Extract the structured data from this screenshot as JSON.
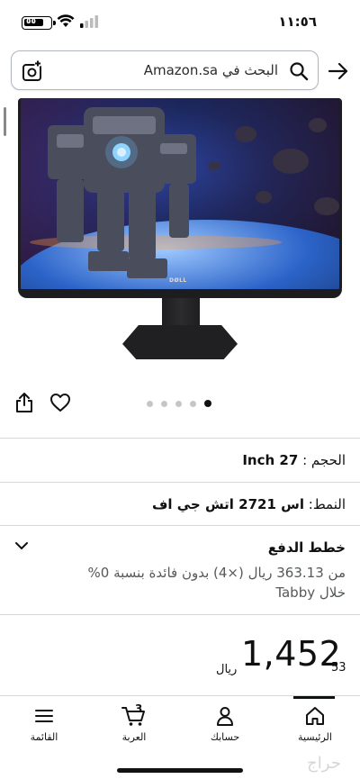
{
  "status_bar": {
    "time": "١١:٥٦",
    "battery_percent": "٥٥"
  },
  "search": {
    "placeholder": "البحث في Amazon.sa"
  },
  "gallery": {
    "image_count": 5,
    "active_index": 4,
    "brand_logo_text": "DØLL"
  },
  "specs": {
    "size": {
      "label": "الحجم :",
      "value": "27 Inch"
    },
    "style": {
      "label": "النمط:",
      "value": "اس 2721 اتش جي اف"
    }
  },
  "payment": {
    "title": "خطط الدفع",
    "description": "من 363.13 ريال (×4) بدون فائدة بنسبة 0% خلال Tabby"
  },
  "price": {
    "whole": "1,452",
    "fraction": "53",
    "currency": "ريال"
  },
  "bottom_nav": {
    "items": [
      {
        "label": "الرئيسية",
        "icon": "home-icon",
        "active": true
      },
      {
        "label": "حسابك",
        "icon": "account-icon",
        "active": false
      },
      {
        "label": "العربة",
        "icon": "cart-icon",
        "active": false,
        "badge": "3"
      },
      {
        "label": "القائمة",
        "icon": "menu-icon",
        "active": false
      }
    ]
  },
  "watermark": {
    "text": "حراج"
  }
}
